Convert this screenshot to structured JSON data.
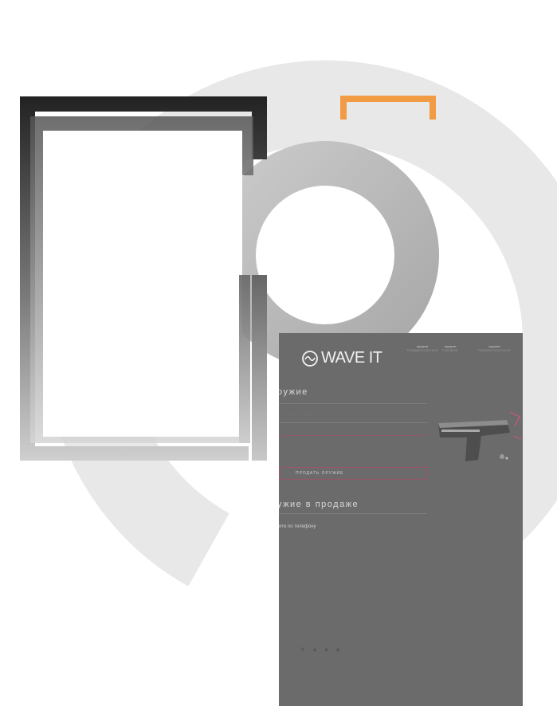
{
  "palette": {
    "ring": "#e9e9e9",
    "dark_frame": "#2b2b2b",
    "accent_orange": "#f29b45",
    "card_bg": "#6b6b6b",
    "accent_pink": "#c45a76"
  },
  "card": {
    "nav": [
      {
        "top": "оружие",
        "bottom": "ТРАВМАТИЧЕСКОЕ"
      },
      {
        "top": "оружие",
        "bottom": "ГАЗОВОЕ"
      },
      {
        "top": "оружие",
        "bottom": "ПНЕВМАТИЧЕСКОЕ"
      }
    ],
    "logo_text": "WAVE IT",
    "heading_weapon": "ружие",
    "ghost_field": "... ... ....",
    "sell_button": "ПРОДАТЬ ОРУЖИЕ",
    "heading_sale": "ужие в продаже",
    "phone_label": "ите по телефону",
    "phone_number": "",
    "body_text": "",
    "footer": {
      "col1": [
        "",
        ""
      ],
      "col2": [
        "",
        ""
      ],
      "col3": [
        "",
        ""
      ]
    }
  }
}
